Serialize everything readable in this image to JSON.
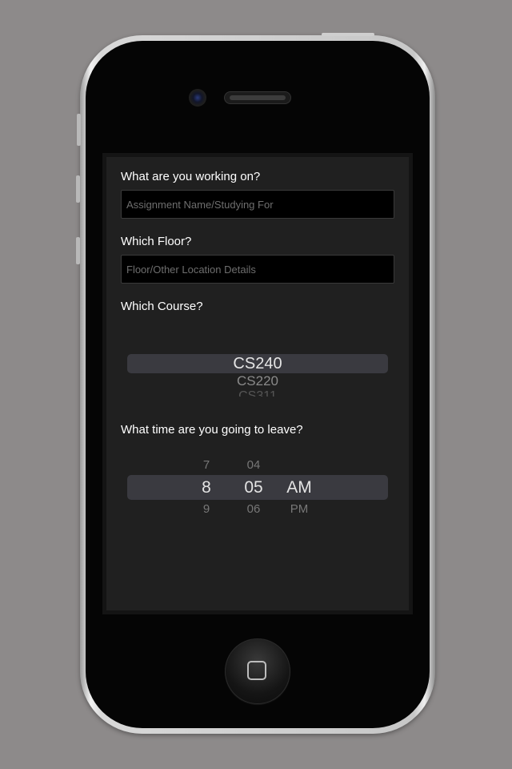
{
  "form": {
    "working_label": "What are you working on?",
    "assignment_placeholder": "Assignment Name/Studying For",
    "floor_label": "Which Floor?",
    "floor_placeholder": "Floor/Other Location Details",
    "course_label": "Which Course?",
    "time_label": "What time are you going to leave?"
  },
  "course_picker": {
    "selected": "CS240",
    "options_below": [
      "CS220",
      "CS311"
    ]
  },
  "time_picker": {
    "hour": {
      "above": "7",
      "selected": "8",
      "below": "9"
    },
    "minute": {
      "above": "04",
      "selected": "05",
      "below": "06"
    },
    "period": {
      "selected": "AM",
      "below": "PM"
    }
  },
  "colors": {
    "screen_bg": "#202020",
    "picker_highlight": "#3a3a40",
    "text": "#ffffff",
    "desktop_bg": "#8d8a8a"
  },
  "icons": {
    "home_button": "home-square-icon",
    "camera": "camera-icon",
    "speaker": "speaker-icon"
  }
}
